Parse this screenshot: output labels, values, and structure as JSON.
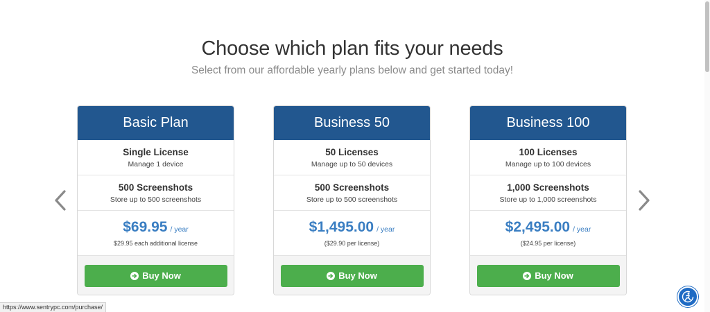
{
  "header": {
    "title": "Choose which plan fits your needs",
    "subtitle": "Select from our affordable yearly plans below and get started today!"
  },
  "plans": [
    {
      "name": "Basic Plan",
      "license_title": "Single License",
      "license_desc": "Manage 1 device",
      "screens_title": "500 Screenshots",
      "screens_desc": "Store up to 500 screenshots",
      "price": "$69.95",
      "period": "/ year",
      "note": "$29.95 each additional license",
      "button": "Buy Now"
    },
    {
      "name": "Business 50",
      "license_title": "50 Licenses",
      "license_desc": "Manage up to 50 devices",
      "screens_title": "500 Screenshots",
      "screens_desc": "Store up to 500 screenshots",
      "price": "$1,495.00",
      "period": "/ year",
      "note": "($29.90 per license)",
      "button": "Buy Now"
    },
    {
      "name": "Business 100",
      "license_title": "100 Licenses",
      "license_desc": "Manage up to 100 devices",
      "screens_title": "1,000 Screenshots",
      "screens_desc": "Store up to 1,000 screenshots",
      "price": "$2,495.00",
      "period": "/ year",
      "note": "($24.95 per license)",
      "button": "Buy Now"
    }
  ],
  "carousel": {
    "prev_icon": "chevron-left-icon",
    "next_icon": "chevron-right-icon"
  },
  "status_bar": {
    "url": "https://www.sentrypc.com/purchase/"
  },
  "accessibility": {
    "icon": "accessibility-icon"
  },
  "colors": {
    "header_blue": "#22578f",
    "price_blue": "#3a7ec2",
    "button_green": "#4cae4c",
    "accessibility_blue": "#1f6bc4"
  }
}
